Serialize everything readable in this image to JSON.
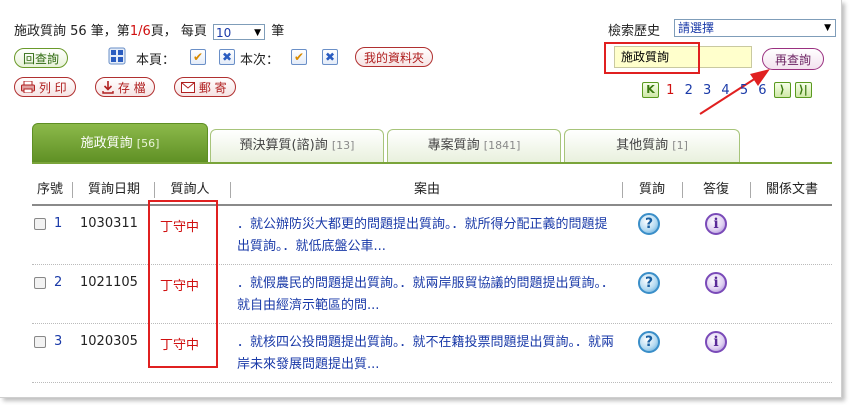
{
  "summary": {
    "prefix": "施政質詢 56 筆，第",
    "page_current": "1",
    "page_sep": "/",
    "page_total": "6",
    "page_suffix": "頁， 每頁",
    "per_page": "10",
    "unit": "筆"
  },
  "toolbar": {
    "back_label": "回查詢",
    "this_page_label": "本頁：",
    "this_time_label": "本次：",
    "check_glyph": "✔",
    "x_glyph": "✖",
    "my_folder_label": "我的資料夾",
    "print_label": "列 印",
    "save_label": "存 檔",
    "mail_label": "郵 寄"
  },
  "search": {
    "history_label": "檢索歷史",
    "history_value": "請選擇",
    "query_value": "施政質詢",
    "requery_label": "再查詢"
  },
  "pager": {
    "first_glyph": "K",
    "pages": [
      "1",
      "2",
      "3",
      "4",
      "5",
      "6"
    ],
    "current": "1",
    "next_glyph": "⟩",
    "last_glyph": "⟩|"
  },
  "tabs": [
    {
      "label": "施政質詢",
      "count": "[56]",
      "active": true
    },
    {
      "label": "預決算質(諮)詢",
      "count": "[13]",
      "active": false
    },
    {
      "label": "專案質詢",
      "count": "[1841]",
      "active": false
    },
    {
      "label": "其他質詢",
      "count": "[1]",
      "active": false
    }
  ],
  "table": {
    "headers": [
      "序號",
      "質詢日期",
      "質詢人",
      "案由",
      "質詢",
      "答復",
      "關係文書"
    ],
    "rows": [
      {
        "no": "1",
        "date": "1030311",
        "person": "丁守中",
        "summary": "．就公辦防災大都更的問題提出質詢。．就所得分配正義的問題提出質詢。．就低底盤公車..."
      },
      {
        "no": "2",
        "date": "1021105",
        "person": "丁守中",
        "summary": "．就假農民的問題提出質詢。．就兩岸服貿協議的問題提出質詢。．就自由經濟示範區的問..."
      },
      {
        "no": "3",
        "date": "1020305",
        "person": "丁守中",
        "summary": "．就核四公投問題提出質詢。．就不在籍投票問題提出質詢。．就兩岸未來發展問題提出質..."
      }
    ]
  },
  "icons": {
    "question_glyph": "?",
    "info_glyph": "i"
  },
  "colors": {
    "accent_green": "#5e8f24",
    "highlight_red": "#e02020",
    "link_blue": "#1a3aa8"
  }
}
